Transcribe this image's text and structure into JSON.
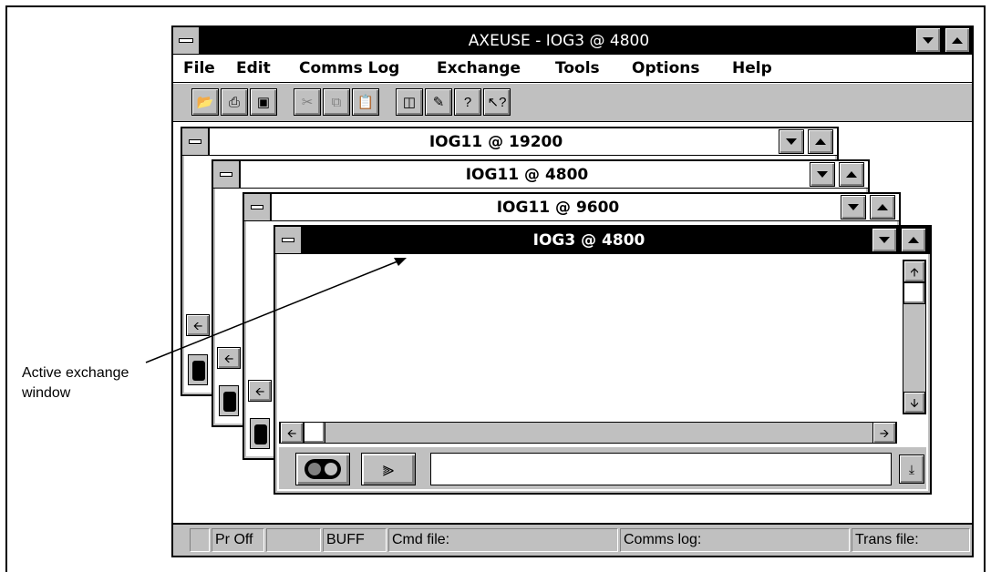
{
  "callout": {
    "line1": "Active exchange",
    "line2": "window"
  },
  "app": {
    "title": "AXEUSE - IOG3 @ 4800",
    "menu": [
      "File",
      "Edit",
      "Comms Log",
      "Exchange",
      "Tools",
      "Options",
      "Help"
    ],
    "toolbar_icons": [
      "open-icon",
      "print-icon",
      "window-icon",
      "cut-icon",
      "copy-icon",
      "paste-icon",
      "book-icon",
      "pen-icon",
      "help-icon",
      "context-help-icon"
    ]
  },
  "windows": [
    {
      "title": "IOG11 @ 19200"
    },
    {
      "title": "IOG11 @ 4800"
    },
    {
      "title": "IOG11 @ 9600"
    },
    {
      "title": "IOG3 @ 4800",
      "active": true
    }
  ],
  "status": {
    "printer": "Pr Off",
    "buffer": "BUFF",
    "cmd_file": "Cmd file:",
    "comms_log": "Comms log:",
    "trans_file": "Trans file:"
  },
  "colors": {
    "active_title": "#000000",
    "chrome": "#c0c0c0"
  }
}
